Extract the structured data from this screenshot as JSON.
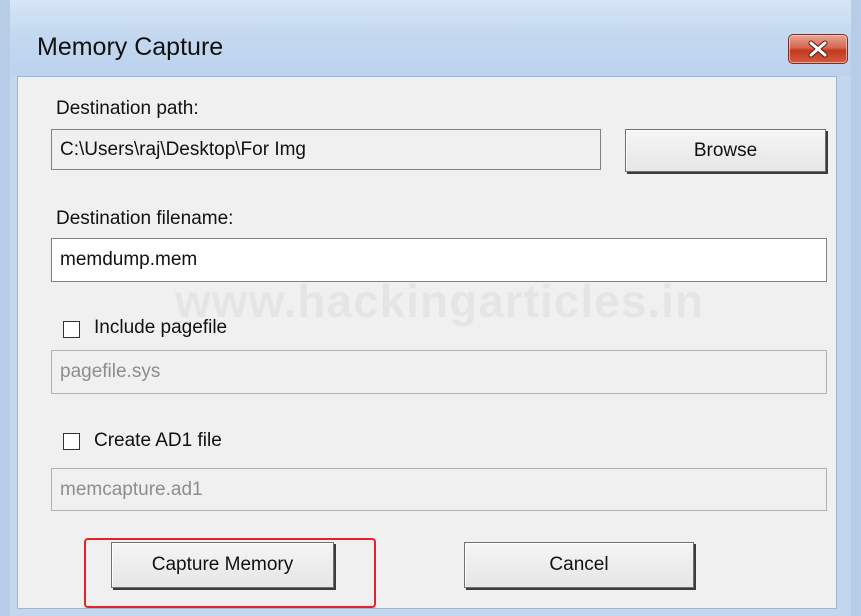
{
  "window": {
    "title": "Memory Capture",
    "close_icon": "close-icon"
  },
  "watermark": "www.hackingarticles.in",
  "destination_path": {
    "label": "Destination path:",
    "value": "C:\\Users\\raj\\Desktop\\For Img",
    "browse_label": "Browse"
  },
  "destination_filename": {
    "label": "Destination filename:",
    "value": "memdump.mem"
  },
  "include_pagefile": {
    "label": "Include pagefile",
    "checked": false,
    "value": "pagefile.sys"
  },
  "create_ad1": {
    "label": "Create AD1 file",
    "checked": false,
    "value": "memcapture.ad1"
  },
  "buttons": {
    "capture_label": "Capture Memory",
    "cancel_label": "Cancel"
  },
  "colors": {
    "highlight": "#e0242c",
    "close_button": "#c2391f",
    "titlebar": "#c4d9f0",
    "dialog_face": "#f0f0f0"
  }
}
